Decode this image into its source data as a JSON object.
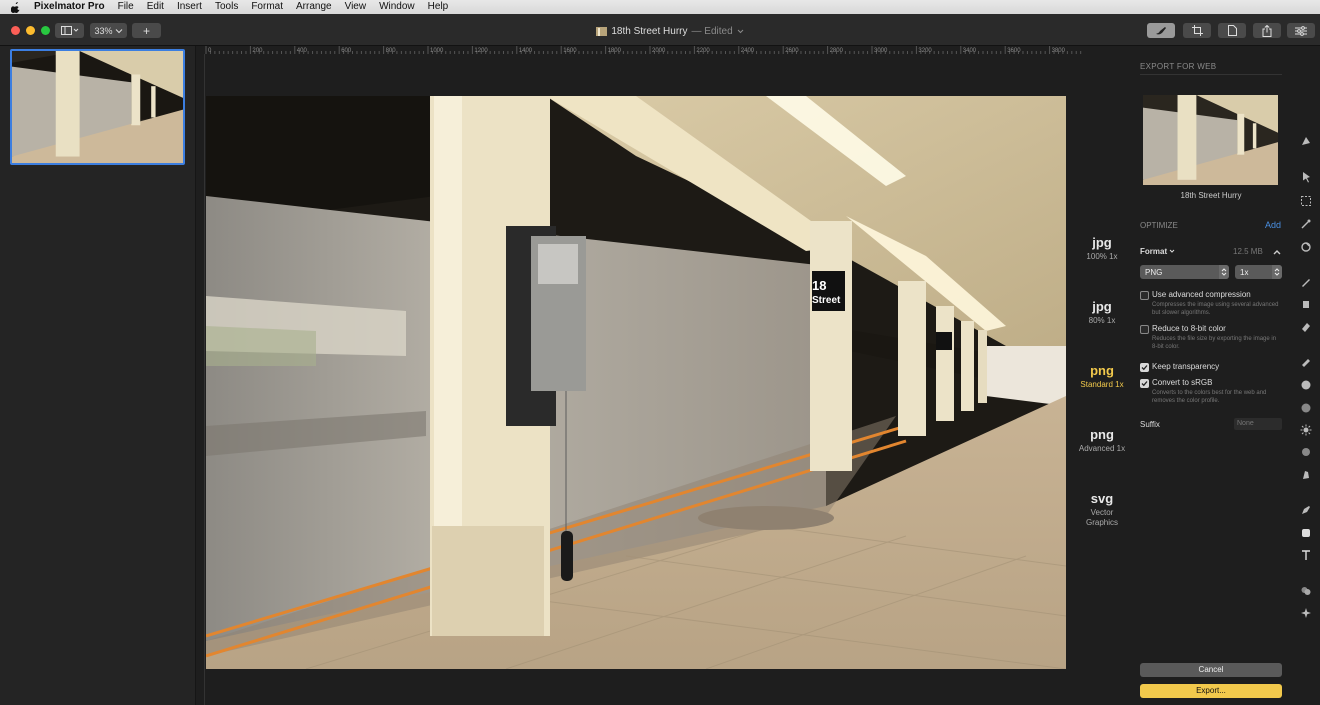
{
  "menubar": {
    "app_name": "Pixelmator Pro",
    "items": [
      "File",
      "Edit",
      "Insert",
      "Tools",
      "Format",
      "Arrange",
      "View",
      "Window",
      "Help"
    ]
  },
  "toolbar": {
    "zoom": "33%",
    "add_label": "+",
    "doc_title": "18th Street Hurry",
    "doc_status": "— Edited"
  },
  "ruler": {
    "top_ticks": [
      "0",
      "200",
      "400",
      "600",
      "800",
      "1000",
      "1200",
      "1400",
      "1600",
      "1800",
      "2000",
      "2200",
      "2400",
      "2600",
      "2800",
      "3000",
      "3200",
      "3400",
      "3600",
      "3800"
    ]
  },
  "formats": [
    {
      "name": "jpg",
      "sub": "100% 1x",
      "active": false
    },
    {
      "name": "jpg",
      "sub": "80% 1x",
      "active": false
    },
    {
      "name": "png",
      "sub": "Standard 1x",
      "active": true
    },
    {
      "name": "png",
      "sub": "Advanced 1x",
      "active": false
    },
    {
      "name": "svg",
      "sub": "Vector Graphics",
      "active": false
    }
  ],
  "panel": {
    "title": "EXPORT FOR WEB",
    "image_name": "18th Street Hurry",
    "optimize_label": "OPTIMIZE",
    "add_label": "Add",
    "format_label": "Format",
    "file_size": "12.5 MB",
    "format_value": "PNG",
    "scale_value": "1x",
    "options": [
      {
        "label": "Use advanced compression",
        "desc": "Compresses the image using several advanced but slower algorithms.",
        "checked": false
      },
      {
        "label": "Reduce to 8-bit color",
        "desc": "Reduces the file size by exporting the image in 8-bit color.",
        "checked": false
      },
      {
        "label": "Keep transparency",
        "desc": "",
        "checked": true
      },
      {
        "label": "Convert to sRGB",
        "desc": "Converts to the colors best for the web and removes the color profile.",
        "checked": true
      }
    ],
    "suffix_label": "Suffix",
    "suffix_placeholder": "None",
    "cancel_label": "Cancel",
    "export_label": "Export..."
  },
  "photo_sign": {
    "line1": "18",
    "line2": "Street"
  },
  "colors": {
    "accent_yellow": "#f2c94c",
    "accent_blue": "#4a90e2",
    "selection_blue": "#3c7ee0"
  }
}
